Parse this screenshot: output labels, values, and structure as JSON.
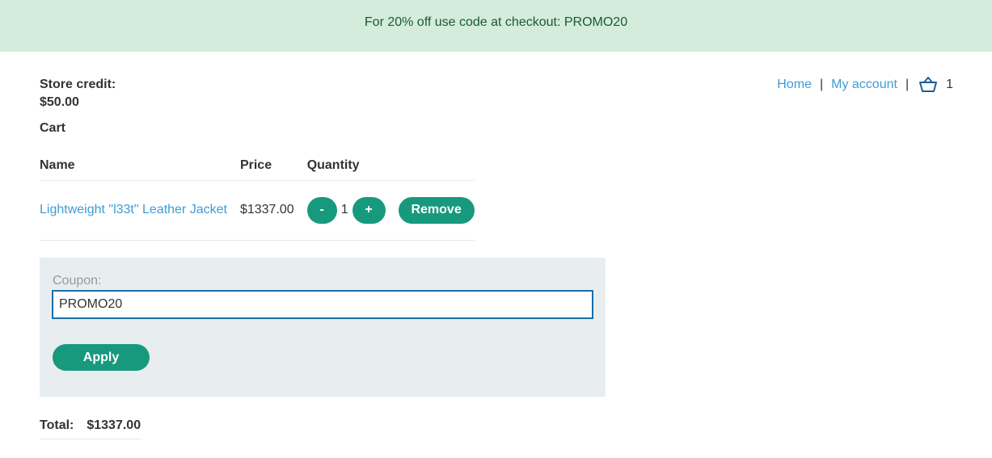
{
  "banner": {
    "text": "For 20% off use code at checkout: PROMO20"
  },
  "nav": {
    "home": "Home",
    "separator": "|",
    "my_account": "My account",
    "basket_icon": "basket-icon",
    "basket_count": "1"
  },
  "store_credit": {
    "label": "Store credit:",
    "value": "$50.00"
  },
  "cart": {
    "heading": "Cart",
    "columns": [
      "Name",
      "Price",
      "Quantity"
    ],
    "items": [
      {
        "name": "Lightweight \"l33t\" Leather Jacket",
        "price": "$1337.00",
        "quantity": "1",
        "minus_label": "-",
        "plus_label": "+",
        "remove_label": "Remove"
      }
    ]
  },
  "coupon": {
    "label": "Coupon:",
    "value": "PROMO20",
    "apply_label": "Apply"
  },
  "total": {
    "label": "Total:",
    "value": "$1337.00"
  },
  "colors": {
    "accent": "#17997d",
    "link": "#3f9cd6",
    "banner_bg": "#d4ecdc",
    "coupon_bg": "#e8eef0"
  }
}
